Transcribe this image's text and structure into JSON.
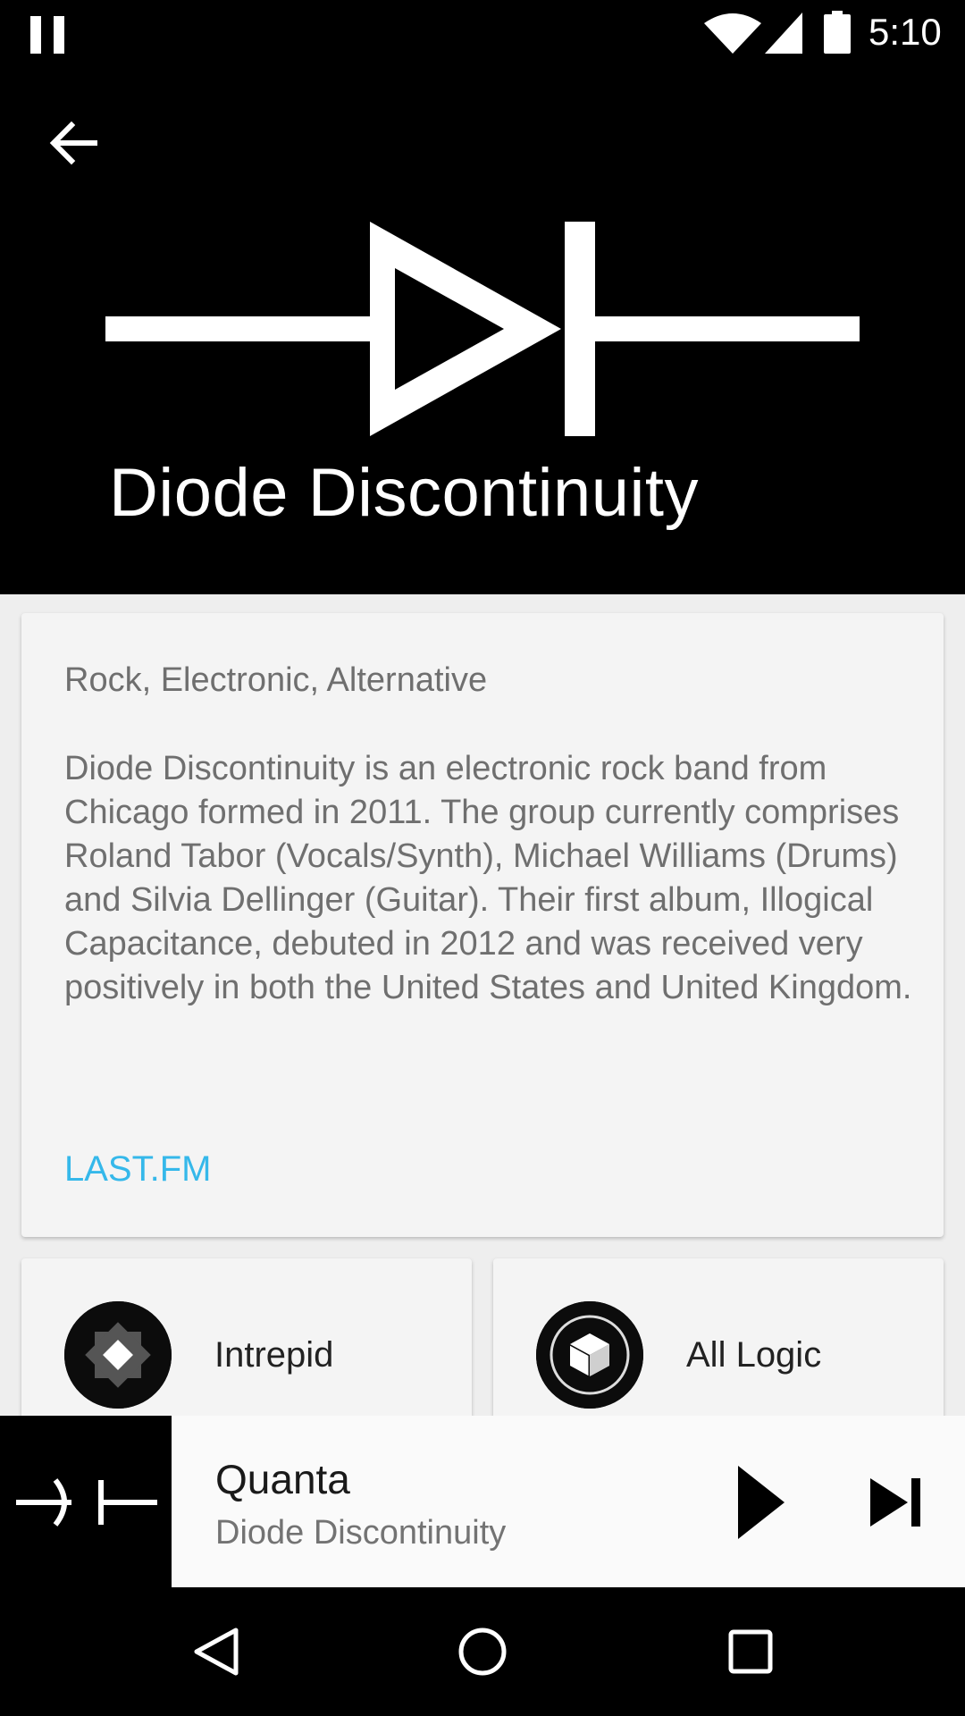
{
  "status_bar": {
    "time": "5:10",
    "icons": [
      "pause-icon",
      "wifi-icon",
      "signal-icon",
      "battery-icon"
    ]
  },
  "header": {
    "back_icon": "arrow-left-icon",
    "logo_icon": "diode-symbol-icon",
    "artist_name": "Diode Discontinuity",
    "background": "#000000"
  },
  "bio": {
    "genres": "Rock, Electronic, Alternative",
    "text": "Diode Discontinuity is an electronic rock band from Chicago formed in 2011. The group currently comprises Roland Tabor (Vocals/Synth), Michael Williams (Drums) and Silvia Dellinger (Guitar). Their first album, Illogical Capacitance, debuted in 2012 and was received very positively in both the United States and United Kingdom.",
    "link_label": "LAST.FM",
    "link_color": "#35b8ea"
  },
  "related_artists": [
    {
      "name": "Intrepid",
      "icon": "diamond-badge-icon"
    },
    {
      "name": "All Logic",
      "icon": "cube-circle-icon"
    }
  ],
  "now_playing": {
    "title": "Quanta",
    "artist": "Diode Discontinuity",
    "art_icon": "capacitor-symbol-icon",
    "controls": [
      "play-icon",
      "skip-next-icon"
    ]
  },
  "nav_bar": {
    "buttons": [
      "nav-back-icon",
      "nav-home-icon",
      "nav-recents-icon"
    ]
  }
}
